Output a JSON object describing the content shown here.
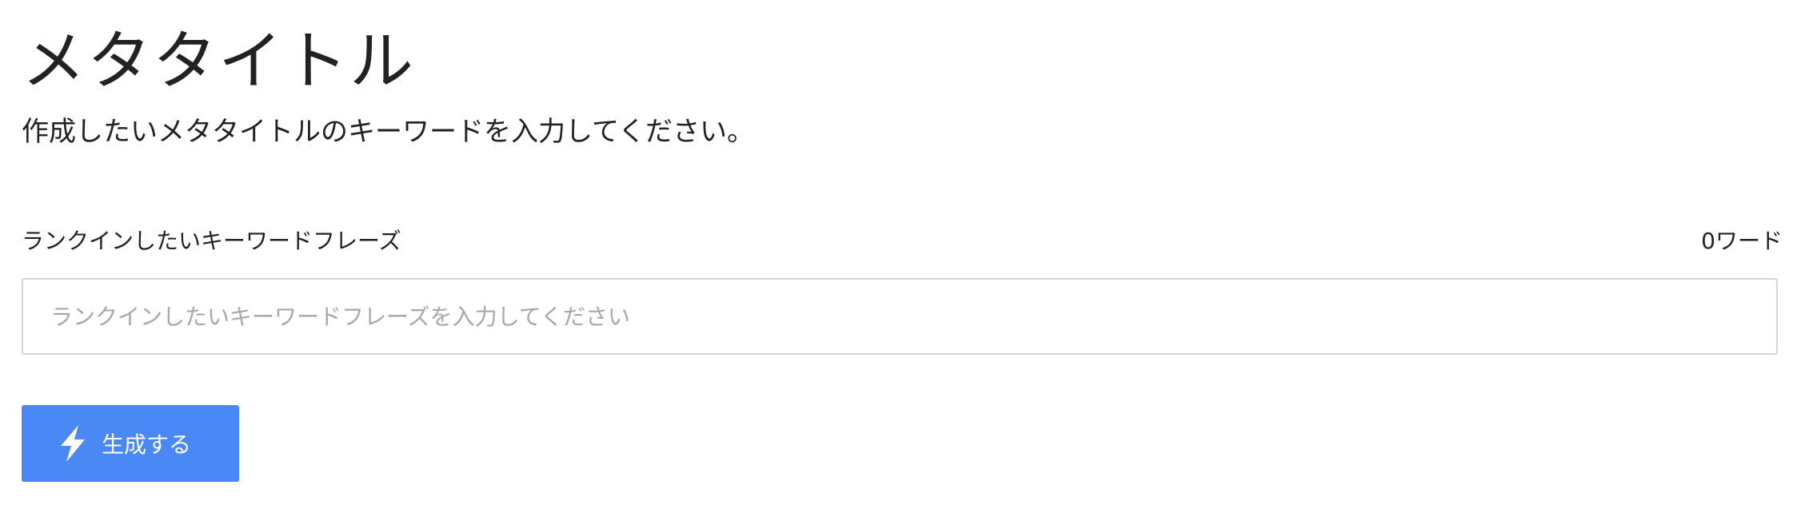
{
  "header": {
    "title": "メタタイトル",
    "description": "作成したいメタタイトルのキーワードを入力してください。"
  },
  "form": {
    "keyword_label": "ランクインしたいキーワードフレーズ",
    "word_count": "0ワード",
    "keyword_input": {
      "value": "",
      "placeholder": "ランクインしたいキーワードフレーズを入力してください"
    },
    "generate_button": {
      "label": "生成する",
      "icon": "lightning-bolt-icon",
      "color": "#4a88f5"
    }
  }
}
